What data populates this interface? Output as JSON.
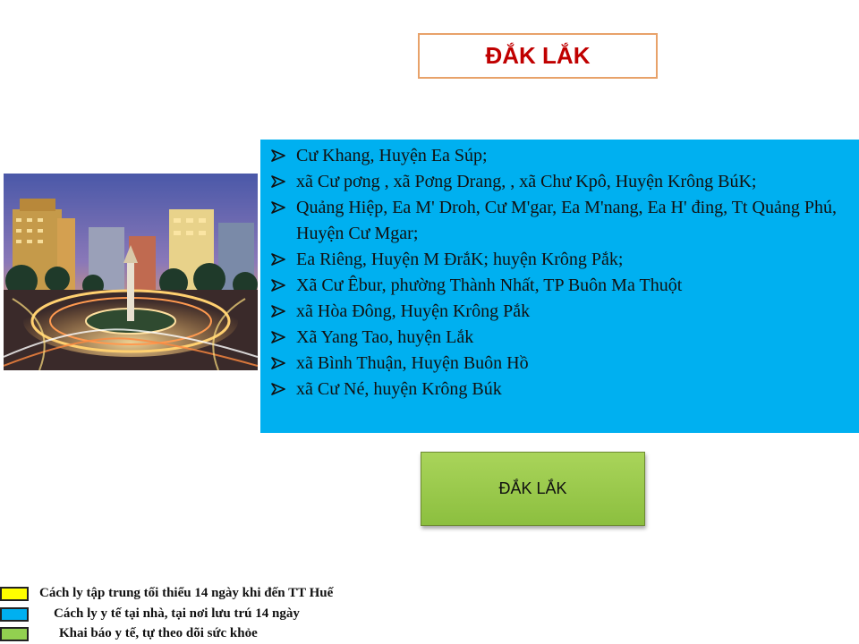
{
  "header": {
    "title": "ĐẮK LẮK"
  },
  "photo": {
    "description_icon": "city-roundabout-photo"
  },
  "list": {
    "bullet_icon": "arrow-bullet-icon",
    "items": [
      "Cư Khang, Huyện Ea Súp;",
      "xã  Cư pơng , xã Pơng Drang, , xã Chư Kpô, Huyện Krông BúK;",
      "Quảng Hiệp, Ea M' Droh, Cư M'gar, Ea M'nang, Ea H' đing, Tt Quảng Phú, Huyện  Cư Mgar;",
      "Ea Riêng, Huyện M ĐrắK; huyện Krông Pắk;",
      "Xã Cư Êbur, phường Thành Nhất, TP Buôn Ma Thuột",
      "xã Hòa Đông,  Huyện Krông Pắk",
      "Xã Yang Tao, huyện Lắk",
      "xã Bình Thuận, Huyện Buôn Hồ",
      "xã Cư Né, huyện Krông Búk"
    ]
  },
  "button": {
    "label": "ĐẮK LẮK"
  },
  "legend": [
    {
      "color": "#ffff00",
      "text": "Cách ly tập trung tối thiểu  14 ngày khi đến TT Huế"
    },
    {
      "color": "#00b0f0",
      "text": "Cách ly y tế tại nhà, tại nơi lưu trú 14 ngày"
    },
    {
      "color": "#92d050",
      "text": "Khai báo y tế, tự theo dõi sức khỏe"
    }
  ]
}
